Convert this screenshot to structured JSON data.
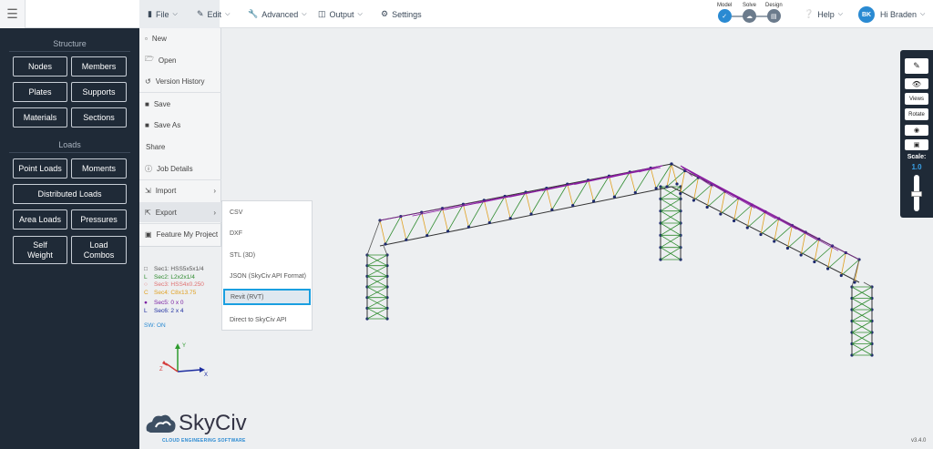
{
  "topbar": {
    "menu": [
      {
        "label": "File"
      },
      {
        "label": "Edit"
      },
      {
        "label": "Advanced"
      },
      {
        "label": "Output"
      },
      {
        "label": "Settings"
      }
    ],
    "workflow": [
      "Model",
      "Solve",
      "Design"
    ],
    "help": "Help",
    "user_initials": "BK",
    "user_greeting": "Hi Braden"
  },
  "sidebar": {
    "structure_title": "Structure",
    "structure_buttons": [
      "Nodes",
      "Members",
      "Plates",
      "Supports",
      "Materials",
      "Sections"
    ],
    "loads_title": "Loads",
    "loads_buttons": [
      "Point Loads",
      "Moments",
      "Distributed Loads",
      "Area Loads",
      "Pressures",
      "Self Weight",
      "Load Combos"
    ]
  },
  "file_menu": {
    "items": [
      "New",
      "Open",
      "Version History",
      "Save",
      "Save As",
      "Share",
      "Job Details",
      "Import",
      "Export",
      "Feature My Project"
    ]
  },
  "export_menu": {
    "items": [
      "CSV",
      "DXF",
      "STL (3D)",
      "JSON (SkyCiv API Format)",
      "Revit (RVT)",
      "Direct to SkyCiv API"
    ]
  },
  "legend": {
    "items": [
      {
        "sym": "□",
        "text": "Sec1: HSS5x5x1/4",
        "color": "#555555"
      },
      {
        "sym": "L",
        "text": "Sec2: L2x2x1/4",
        "color": "#2e8b2e"
      },
      {
        "sym": "○",
        "text": "Sec3: HSS4x0.250",
        "color": "#e07070"
      },
      {
        "sym": "C",
        "text": "Sec4: C8x13.75",
        "color": "#e0a020"
      },
      {
        "sym": "●",
        "text": "Sec5: 0 x 0",
        "color": "#7a1fa2"
      },
      {
        "sym": "L",
        "text": "Sec6: 2 x 4",
        "color": "#1e2ea0"
      }
    ],
    "sw": "SW: ON"
  },
  "axes": {
    "x": "X",
    "y": "Y",
    "z": "Z"
  },
  "toolbar": {
    "views": "Views",
    "rotate": "Rotate",
    "scale_label": "Scale:",
    "scale_value": "1.0"
  },
  "brand": {
    "name": "SkyCiv",
    "tagline": "CLOUD ENGINEERING SOFTWARE"
  },
  "version": "v3.4.0",
  "colors": {
    "accent": "#2a8ad2",
    "sidebar": "#1f2a37",
    "highlight": "#1a9fe0"
  }
}
